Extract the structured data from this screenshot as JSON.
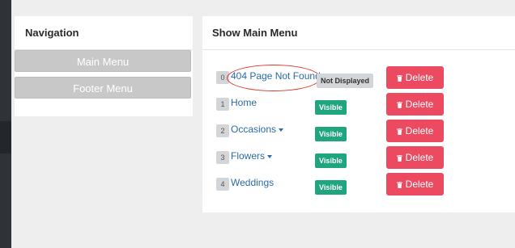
{
  "navigation": {
    "title": "Navigation",
    "items": [
      {
        "label": "Main Menu"
      },
      {
        "label": "Footer Menu"
      }
    ]
  },
  "main": {
    "title": "Show Main Menu",
    "items": [
      {
        "order": "0",
        "label": "404 Page Not Found",
        "status": "Not Displayed",
        "has_dropdown": false,
        "delete_label": "Delete"
      },
      {
        "order": "1",
        "label": "Home",
        "status": "Visible",
        "has_dropdown": false,
        "delete_label": "Delete"
      },
      {
        "order": "2",
        "label": "Occasions",
        "status": "Visible",
        "has_dropdown": true,
        "delete_label": "Delete"
      },
      {
        "order": "3",
        "label": "Flowers",
        "status": "Visible",
        "has_dropdown": true,
        "delete_label": "Delete"
      },
      {
        "order": "4",
        "label": "Weddings",
        "status": "Visible",
        "has_dropdown": false,
        "delete_label": "Delete"
      }
    ]
  },
  "colors": {
    "visible_badge": "#1fa67f",
    "hidden_badge": "#d2d6d9",
    "delete_button": "#ec4a60",
    "link": "#2a6aa8",
    "highlight": "#d9362b"
  },
  "icons": {
    "delete": "trash-icon",
    "dropdown": "caret-down-icon"
  }
}
